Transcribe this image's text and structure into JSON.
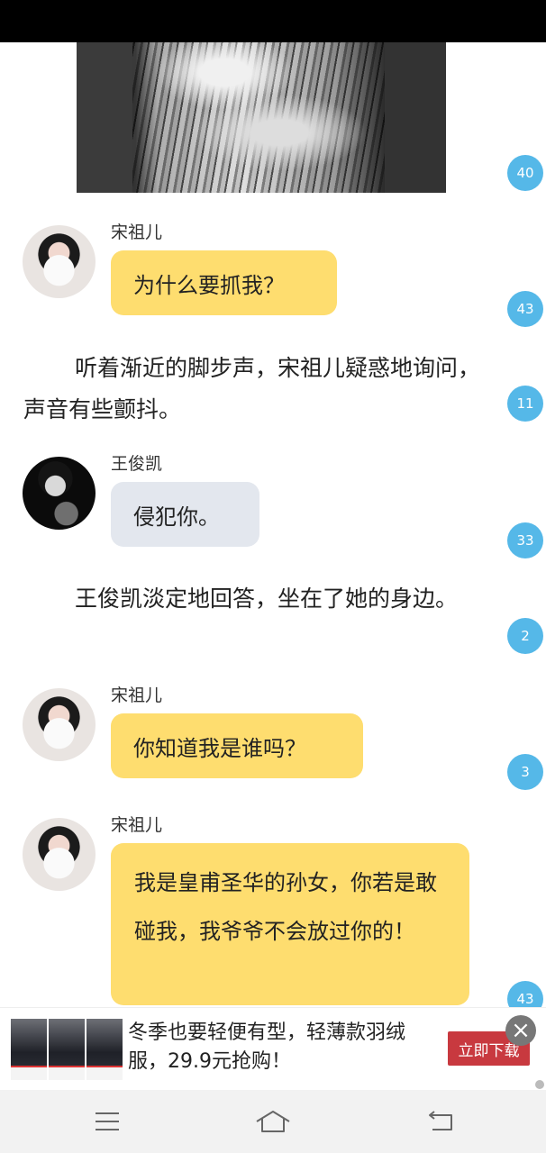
{
  "comment_counts": [
    "40",
    "43",
    "11",
    "33",
    "2",
    "3",
    "43"
  ],
  "messages": [
    {
      "speaker": "宋祖儿",
      "text": "为什么要抓我？"
    },
    {
      "speaker": "王俊凯",
      "text": "侵犯你。"
    },
    {
      "speaker": "宋祖儿",
      "text": "你知道我是谁吗？"
    },
    {
      "speaker": "宋祖儿",
      "text": "我是皇甫圣华的孙女，你若是敢碰我，我爷爷不会放过你的！"
    }
  ],
  "narrations": [
    "听着渐近的脚步声，宋祖儿疑惑地询问，声音有些颤抖。",
    "王俊凯淡定地回答，坐在了她的身边。"
  ],
  "ad": {
    "text": "冬季也要轻便有型，轻薄款羽绒服，29.9元抢购！",
    "button_label": "立即下载"
  },
  "navbar": {
    "icons": [
      "menu-icon",
      "home-icon",
      "back-icon"
    ]
  },
  "colors": {
    "yellow_bubble": "#fedd6f",
    "grey_bubble": "#e3e7ee",
    "count_badge": "#55b8e8",
    "ad_button": "#c8393f"
  }
}
